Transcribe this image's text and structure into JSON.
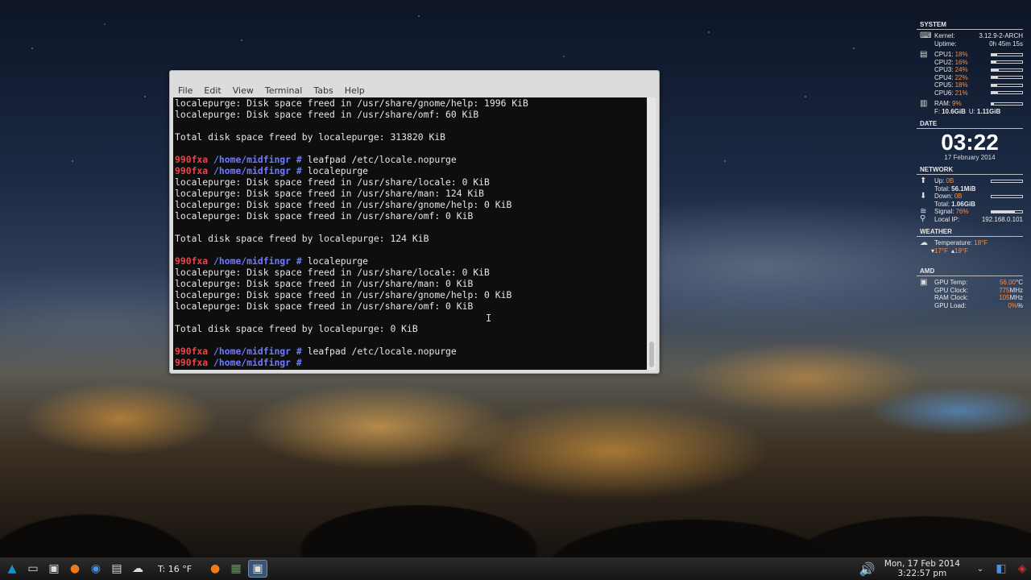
{
  "terminal": {
    "menu": [
      "File",
      "Edit",
      "View",
      "Terminal",
      "Tabs",
      "Help"
    ],
    "lines": [
      {
        "type": "out",
        "text": "localepurge: Disk space freed in /usr/share/gnome/help: 1996 KiB"
      },
      {
        "type": "out",
        "text": "localepurge: Disk space freed in /usr/share/omf: 60 KiB"
      },
      {
        "type": "out",
        "text": ""
      },
      {
        "type": "out",
        "text": "Total disk space freed by localepurge: 313820 KiB"
      },
      {
        "type": "out",
        "text": ""
      },
      {
        "type": "prompt",
        "host": "990fxa",
        "path": "/home/midfingr",
        "sym": "#",
        "cmd": "leafpad /etc/locale.nopurge"
      },
      {
        "type": "prompt",
        "host": "990fxa",
        "path": "/home/midfingr",
        "sym": "#",
        "cmd": "localepurge"
      },
      {
        "type": "out",
        "text": "localepurge: Disk space freed in /usr/share/locale: 0 KiB"
      },
      {
        "type": "out",
        "text": "localepurge: Disk space freed in /usr/share/man: 124 KiB"
      },
      {
        "type": "out",
        "text": "localepurge: Disk space freed in /usr/share/gnome/help: 0 KiB"
      },
      {
        "type": "out",
        "text": "localepurge: Disk space freed in /usr/share/omf: 0 KiB"
      },
      {
        "type": "out",
        "text": ""
      },
      {
        "type": "out",
        "text": "Total disk space freed by localepurge: 124 KiB"
      },
      {
        "type": "out",
        "text": ""
      },
      {
        "type": "prompt",
        "host": "990fxa",
        "path": "/home/midfingr",
        "sym": "#",
        "cmd": "localepurge"
      },
      {
        "type": "out",
        "text": "localepurge: Disk space freed in /usr/share/locale: 0 KiB"
      },
      {
        "type": "out",
        "text": "localepurge: Disk space freed in /usr/share/man: 0 KiB"
      },
      {
        "type": "out",
        "text": "localepurge: Disk space freed in /usr/share/gnome/help: 0 KiB"
      },
      {
        "type": "out",
        "text": "localepurge: Disk space freed in /usr/share/omf: 0 KiB"
      },
      {
        "type": "out",
        "text": ""
      },
      {
        "type": "out",
        "text": "Total disk space freed by localepurge: 0 KiB"
      },
      {
        "type": "out",
        "text": ""
      },
      {
        "type": "prompt",
        "host": "990fxa",
        "path": "/home/midfingr",
        "sym": "#",
        "cmd": "leafpad /etc/locale.nopurge"
      },
      {
        "type": "prompt",
        "host": "990fxa",
        "path": "/home/midfingr",
        "sym": "#",
        "cmd": ""
      }
    ]
  },
  "conky": {
    "system": {
      "title": "SYSTEM",
      "kernel_label": "Kernel:",
      "kernel": "3.12.9-2-ARCH",
      "uptime_label": "Uptime:",
      "uptime": "0h 45m 15s",
      "cpus": [
        {
          "label": "CPU1:",
          "value": "18%",
          "fill": 0.18
        },
        {
          "label": "CPU2:",
          "value": "16%",
          "fill": 0.16
        },
        {
          "label": "CPU3:",
          "value": "24%",
          "fill": 0.24
        },
        {
          "label": "CPU4:",
          "value": "22%",
          "fill": 0.22
        },
        {
          "label": "CPU5:",
          "value": "18%",
          "fill": 0.18
        },
        {
          "label": "CPU6:",
          "value": "21%",
          "fill": 0.21
        }
      ],
      "ram_label": "RAM:",
      "ram": "9%",
      "ram_fill": 0.09,
      "free_label": "F:",
      "free": "10.6GiB",
      "used_label": "U:",
      "used": "1.11GiB"
    },
    "date": {
      "title": "DATE",
      "time": "03:22",
      "date": "17 February 2014"
    },
    "network": {
      "title": "NETWORK",
      "up_label": "Up:",
      "up": "0B",
      "up_total_label": "Total:",
      "up_total": "56.1MiB",
      "down_label": "Down:",
      "down": "0B",
      "down_total_label": "Total:",
      "down_total": "1.06GiB",
      "signal_label": "Signal:",
      "signal": "76%",
      "signal_fill": 0.76,
      "ip_label": "Local IP:",
      "ip": "192.168.0.101"
    },
    "weather": {
      "title": "WEATHER",
      "temp_label": "Temperature:",
      "temp": "18°F",
      "low": "17°F",
      "high": "19°F"
    },
    "amd": {
      "title": "AMD",
      "rows": [
        {
          "label": "GPU Temp:",
          "value": "56.00",
          "unit": "°C"
        },
        {
          "label": "GPU Clock:",
          "value": "775",
          "unit": "MHz"
        },
        {
          "label": "RAM Clock:",
          "value": "105",
          "unit": "MHz"
        },
        {
          "label": "GPU Load:",
          "value": "0%",
          "unit": "%"
        }
      ]
    }
  },
  "taskbar": {
    "weather": "T: 16 °F",
    "clock_date": "Mon, 17 Feb 2014",
    "clock_time": "3:22:57 pm"
  },
  "colors": {
    "prompt_host": "#e8454a",
    "prompt_path": "#6f7bff",
    "conky_accent": "#ff8c3a",
    "taskbar_active": "#3b5470"
  }
}
